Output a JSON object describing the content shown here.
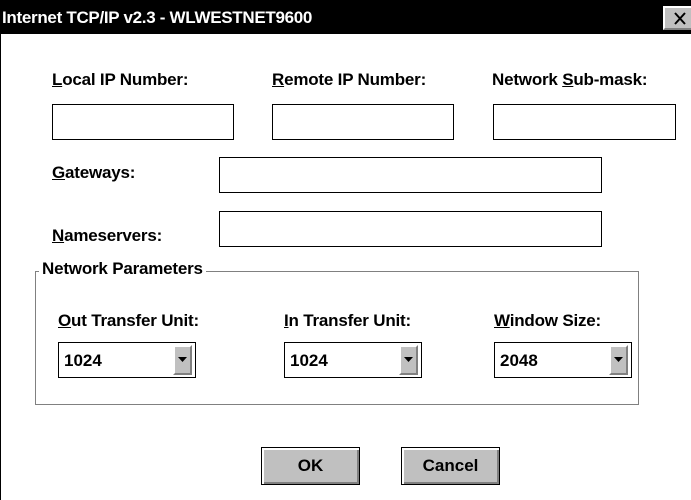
{
  "window": {
    "title": "Internet TCP/IP v2.3 - WLWESTNET9600",
    "close_icon": "close-x-icon"
  },
  "fields": {
    "local_ip": {
      "mnemonic": "L",
      "rest": "ocal IP Number:",
      "value": ""
    },
    "remote_ip": {
      "mnemonic": "R",
      "rest": "emote IP Number:",
      "value": ""
    },
    "subnet_mask": {
      "prefix": "Network ",
      "mnemonic": "S",
      "rest": "ub-mask:",
      "value": ""
    },
    "gateways": {
      "mnemonic": "G",
      "rest": "ateways:",
      "value": ""
    },
    "nameservers": {
      "mnemonic": "N",
      "rest": "ameservers:",
      "value": ""
    }
  },
  "network_parameters": {
    "title": "Network Parameters",
    "out_transfer_unit": {
      "mnemonic": "O",
      "rest": "ut Transfer Unit:",
      "selected": "1024"
    },
    "in_transfer_unit": {
      "mnemonic": "I",
      "rest": "n Transfer Unit:",
      "selected": "1024"
    },
    "window_size": {
      "mnemonic": "W",
      "rest": "indow Size:",
      "selected": "2048"
    }
  },
  "buttons": {
    "ok": "OK",
    "cancel": "Cancel"
  },
  "colors": {
    "titlebar": "#000000",
    "title_text": "#ffffff",
    "face": "#c0c0c0",
    "shadow": "#808080",
    "background": "#ffffff"
  }
}
